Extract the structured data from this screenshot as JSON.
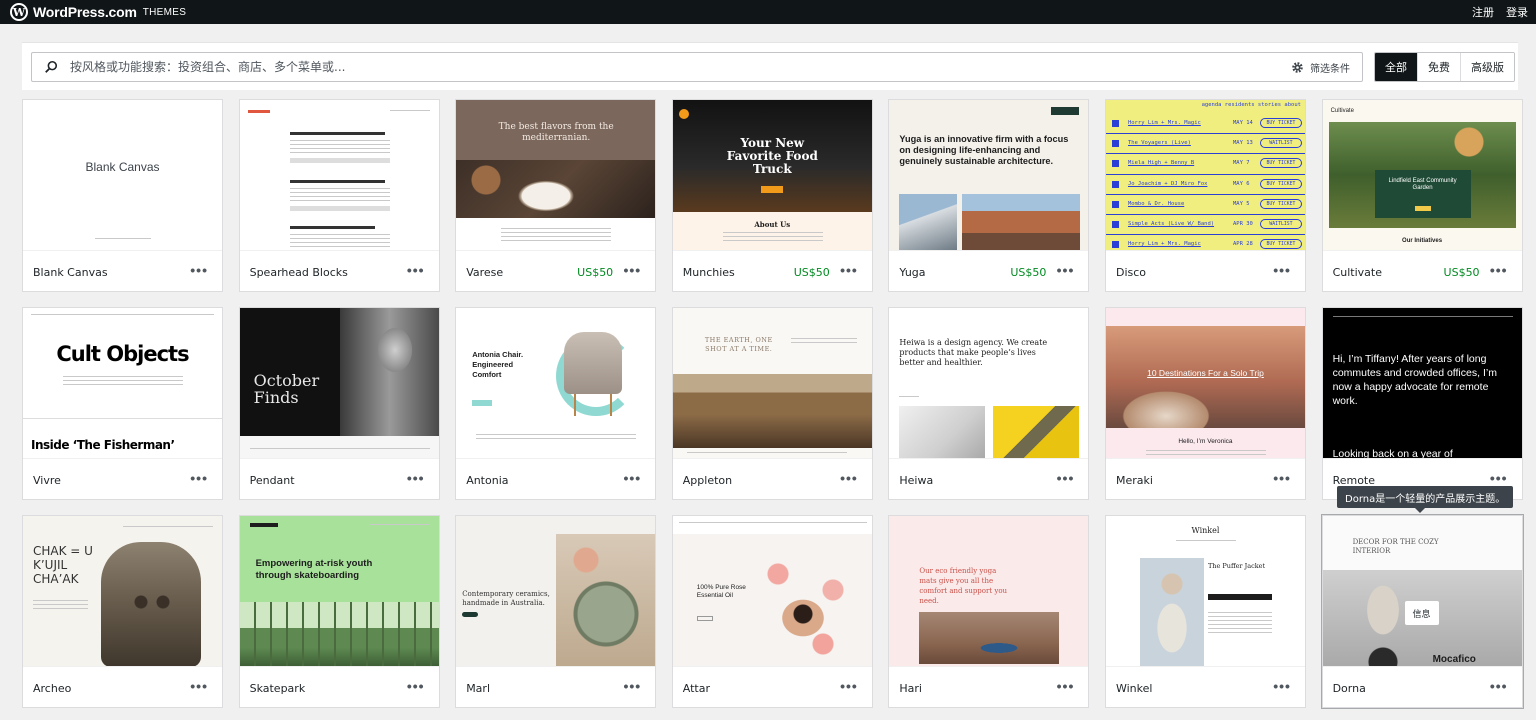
{
  "topbar": {
    "brand_name": "WordPress.com",
    "brand_sub": "THEMES",
    "register": "注册",
    "login": "登录"
  },
  "search": {
    "placeholder": "按风格或功能搜索：投资组合、商店、多个菜单或...",
    "filter_label": "筛选条件"
  },
  "tier_filter": {
    "all": "全部",
    "free": "免费",
    "premium": "高级版"
  },
  "themes": [
    {
      "name": "Blank Canvas",
      "price": ""
    },
    {
      "name": "Spearhead Blocks",
      "price": ""
    },
    {
      "name": "Varese",
      "price": "US$50"
    },
    {
      "name": "Munchies",
      "price": "US$50"
    },
    {
      "name": "Yuga",
      "price": "US$50"
    },
    {
      "name": "Disco",
      "price": ""
    },
    {
      "name": "Cultivate",
      "price": "US$50"
    },
    {
      "name": "Vivre",
      "price": ""
    },
    {
      "name": "Pendant",
      "price": ""
    },
    {
      "name": "Antonia",
      "price": ""
    },
    {
      "name": "Appleton",
      "price": ""
    },
    {
      "name": "Heiwa",
      "price": ""
    },
    {
      "name": "Meraki",
      "price": ""
    },
    {
      "name": "Remote",
      "price": ""
    },
    {
      "name": "Archeo",
      "price": ""
    },
    {
      "name": "Skatepark",
      "price": ""
    },
    {
      "name": "Marl",
      "price": ""
    },
    {
      "name": "Attar",
      "price": ""
    },
    {
      "name": "Hari",
      "price": ""
    },
    {
      "name": "Winkel",
      "price": ""
    },
    {
      "name": "Dorna",
      "price": ""
    }
  ],
  "more_glyph": "•••",
  "previews": {
    "blank_canvas": "Blank Canvas",
    "varese": "The best flavors from the mediterranian.",
    "munchies_a": "Your New",
    "munchies_b": "Favorite Food",
    "munchies_c": "Truck",
    "munchies_about": "About Us",
    "yuga": "Yuga is an innovative firm with a focus on designing life-enhancing and genuinely sustainable architecture.",
    "disco_rows": [
      {
        "act": "Horry Lim + Mrs. Magic",
        "date": "MAY 14",
        "btn": "BUY TICKET"
      },
      {
        "act": "The Voyagers (Live)",
        "date": "MAY 13",
        "btn": "WAITLIST"
      },
      {
        "act": "Miela High + Benny B",
        "date": "MAY 7",
        "btn": "BUY TICKET"
      },
      {
        "act": "Jo Joachim + DJ Miro Fox",
        "date": "MAY 6",
        "btn": "BUY TICKET"
      },
      {
        "act": "Mombo & Dr. House",
        "date": "MAY 5",
        "btn": "BUY TICKET"
      },
      {
        "act": "Simple Acts (Live W/ Band)",
        "date": "APR 30",
        "btn": "WAITLIST"
      },
      {
        "act": "Horry Lim + Mrs. Magic",
        "date": "APR 28",
        "btn": "BUY TICKET"
      }
    ],
    "disco_nav": "agenda  residents  stories  about",
    "cultivate_title": "Cultivate",
    "cultivate_card": "Lindfield East Community Garden",
    "cultivate_bottom": "Our Initiatives",
    "vivre_title": "Cult Objects",
    "vivre_sub": "Inside ‘The Fisherman’",
    "pendant": "October Finds",
    "antonia": "Antonia Chair. Engineered Comfort",
    "appleton": "THE EARTH, ONE SHOT AT A TIME.",
    "heiwa": "Heiwa is a design agency. We create products that make people’s lives better and healthier.",
    "meraki_title": "10 Destinations For a Solo Trip",
    "meraki_sub": "Hello, I’m Veronica",
    "remote": "Hi, I’m Tiffany! After years of long commutes and crowded offices, I’m now a happy advocate for remote work.",
    "remote_bottom": "Looking back on a year of",
    "archeo": "CHAK = U K’UJIL CHA’AK",
    "skatepark": "Empowering at-risk youth through skateboarding",
    "marl": "Contemporary ceramics, handmade in Australia.",
    "attar": "100% Pure Rose Essential Oil",
    "hari": "Our eco friendly yoga mats give you all the comfort and support you need.",
    "winkel_title": "Winkel",
    "winkel_product": "The Puffer Jacket",
    "dorna": "DECOR FOR THE COZY INTERIOR",
    "dorna_info": "信息",
    "dorna_bottom": "Mocafico"
  },
  "tooltip": "Dorna是一个轻量的产品展示主题。",
  "colors": {
    "topbar": "#101517",
    "price": "#008a20",
    "disco_yellow": "#f1ee80",
    "disco_blue": "#2a3fd6",
    "skatepark_green": "#a8e19a"
  }
}
